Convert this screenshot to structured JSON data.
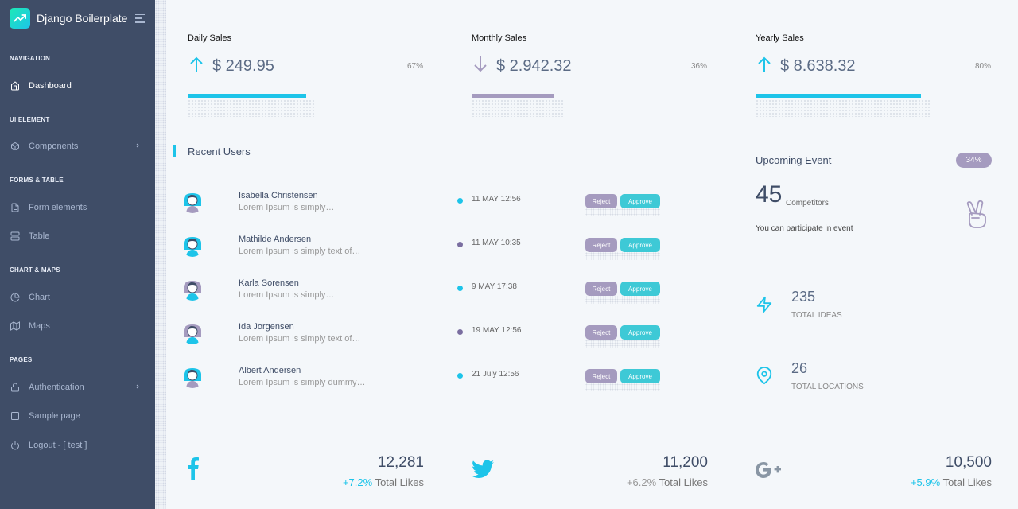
{
  "brand": {
    "title": "Django Boilerplate"
  },
  "nav": {
    "captions": [
      "Navigation",
      "UI Element",
      "Forms & Table",
      "Chart & Maps",
      "Pages"
    ],
    "items": [
      {
        "label": "Dashboard",
        "icon": "home-icon"
      },
      {
        "label": "Components",
        "icon": "box-icon"
      },
      {
        "label": "Form elements",
        "icon": "file-text-icon"
      },
      {
        "label": "Table",
        "icon": "server-icon"
      },
      {
        "label": "Chart",
        "icon": "pie-chart-icon"
      },
      {
        "label": "Maps",
        "icon": "map-icon"
      },
      {
        "label": "Authentication",
        "icon": "lock-icon"
      },
      {
        "label": "Sample page",
        "icon": "sidebar-icon"
      },
      {
        "label": "Logout - [ test ]",
        "icon": "power-icon"
      }
    ]
  },
  "sales": [
    {
      "title": "Daily Sales",
      "amount": "$ 249.95",
      "percent": "67%",
      "progress": 67,
      "trend": "up",
      "color": "#1dc4e9"
    },
    {
      "title": "Monthly Sales",
      "amount": "$ 2.942.32",
      "percent": "36%",
      "progress": 36,
      "trend": "down",
      "color": "#a59bbf"
    },
    {
      "title": "Yearly Sales",
      "amount": "$ 8.638.32",
      "percent": "80%",
      "progress": 80,
      "trend": "up",
      "color": "#1dc4e9"
    }
  ],
  "recent_users": {
    "title": "Recent Users",
    "reject_label": "Reject",
    "approve_label": "Approve",
    "rows": [
      {
        "name": "Isabella Christensen",
        "desc": "Lorem Ipsum is simply…",
        "date": "11 MAY 12:56",
        "status": "teal"
      },
      {
        "name": "Mathilde Andersen",
        "desc": "Lorem Ipsum is simply text of…",
        "date": "11 MAY 10:35",
        "status": "purple"
      },
      {
        "name": "Karla Sorensen",
        "desc": "Lorem Ipsum is simply…",
        "date": "9 MAY 17:38",
        "status": "teal"
      },
      {
        "name": "Ida Jorgensen",
        "desc": "Lorem Ipsum is simply text of…",
        "date": "19 MAY 12:56",
        "status": "purple"
      },
      {
        "name": "Albert Andersen",
        "desc": "Lorem Ipsum is simply dummy…",
        "date": "21 July 12:56",
        "status": "teal"
      }
    ]
  },
  "event": {
    "title": "Upcoming Event",
    "badge": "34%",
    "count": "45",
    "count_label": "Competitors",
    "desc": "You can participate in event"
  },
  "stats": [
    {
      "value": "235",
      "label": "Total Ideas",
      "icon": "zap-icon"
    },
    {
      "value": "26",
      "label": "Total Locations",
      "icon": "map-pin-icon"
    }
  ],
  "social": [
    {
      "icon": "facebook-icon",
      "value": "12,281",
      "delta": "+7.2%",
      "delta_color": "teal",
      "label": "Total Likes"
    },
    {
      "icon": "twitter-icon",
      "value": "11,200",
      "delta": "+6.2%",
      "delta_color": "grey",
      "label": "Total Likes"
    },
    {
      "icon": "google-plus-icon",
      "value": "10,500",
      "delta": "+5.9%",
      "delta_color": "teal",
      "label": "Total Likes"
    }
  ],
  "colors": {
    "sidebar": "#3f4d67",
    "accent": "#1dc4e9",
    "muted_purple": "#a59bbf",
    "background": "#f4f7fa"
  }
}
